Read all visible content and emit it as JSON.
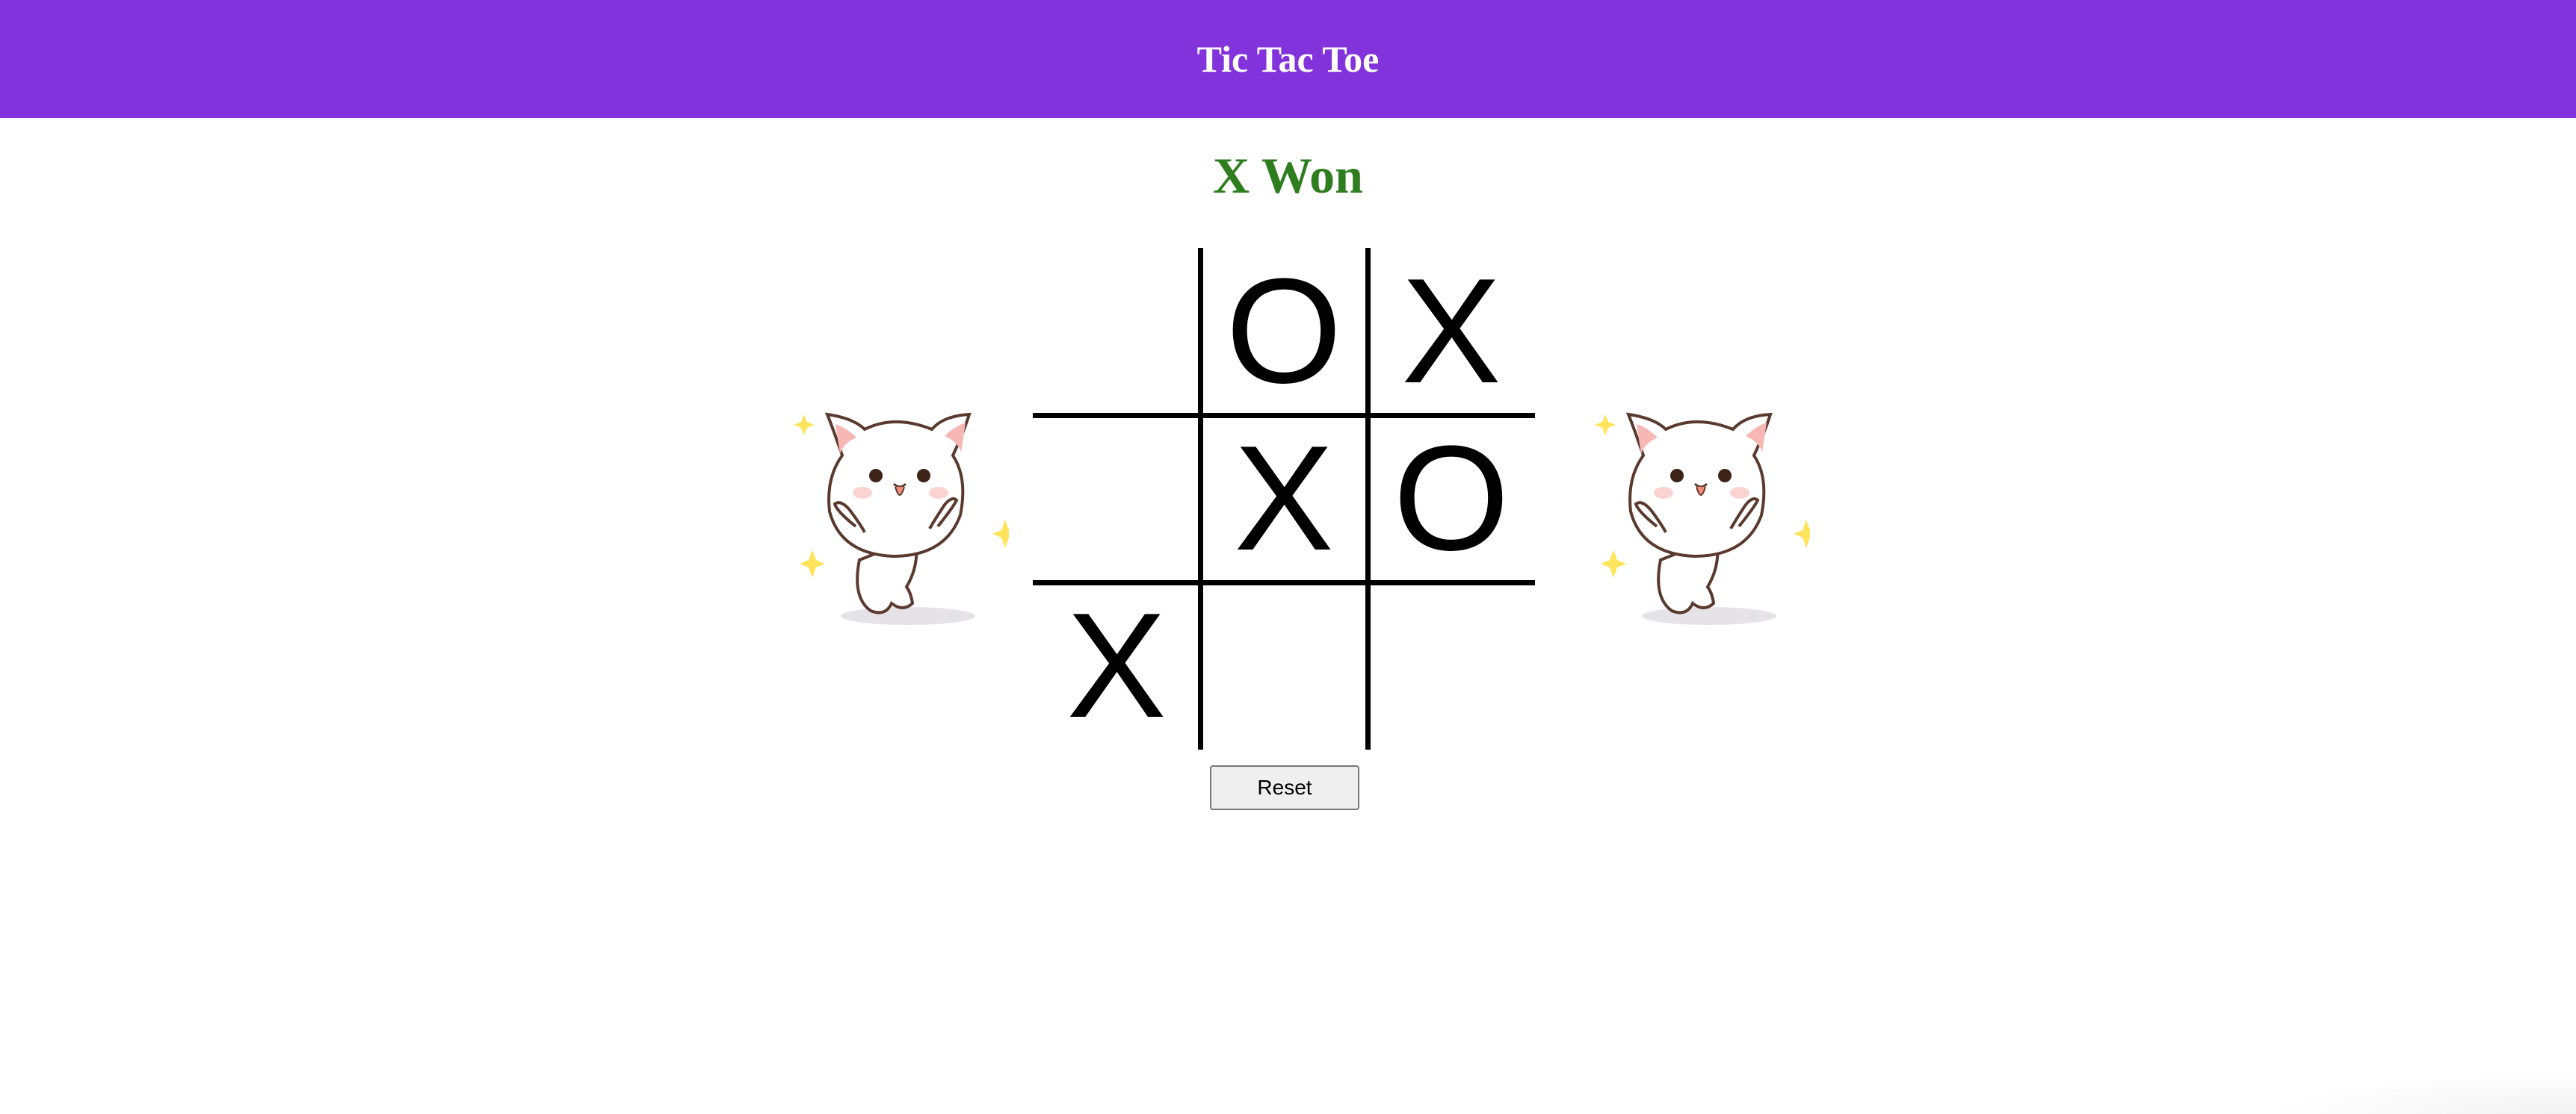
{
  "header": {
    "title": "Tic Tac Toe"
  },
  "status": {
    "text": "X Won"
  },
  "board": {
    "cells": [
      "",
      "O",
      "X",
      "",
      "X",
      "O",
      "X",
      "",
      ""
    ]
  },
  "controls": {
    "reset_label": "Reset"
  },
  "colors": {
    "header_bg": "#8233dc",
    "status_text": "#2e7d1f",
    "grid_lines": "#000000"
  },
  "decorations": {
    "left_sticker": "happy-cat-sticker",
    "right_sticker": "happy-cat-sticker"
  }
}
